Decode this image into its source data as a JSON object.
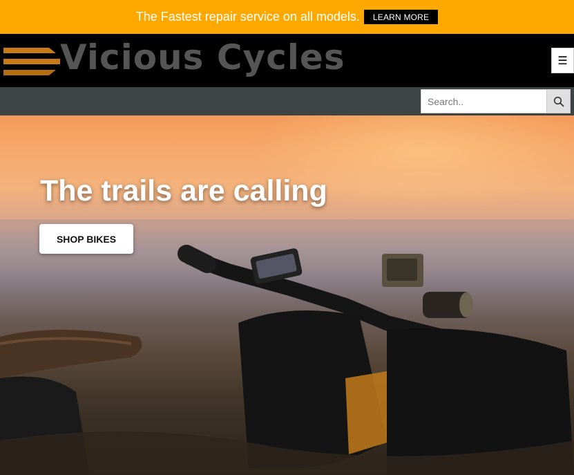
{
  "promo": {
    "text": "The Fastest repair service on all models.",
    "button_label": "LEARN MORE"
  },
  "header": {
    "brand": "Vicious Cycles",
    "menu_icon": "☰"
  },
  "search": {
    "placeholder": "Search.."
  },
  "hero": {
    "title": "The trails are calling",
    "cta_label": "SHOP BIKES"
  },
  "colors": {
    "promo_bg": "#ffa800",
    "header_bg": "#000000",
    "searchbar_bg": "#3e4443",
    "logo_stripe": "#c77a16",
    "logo_text": "#555555"
  },
  "icons": [
    "menu-icon",
    "search-icon"
  ]
}
